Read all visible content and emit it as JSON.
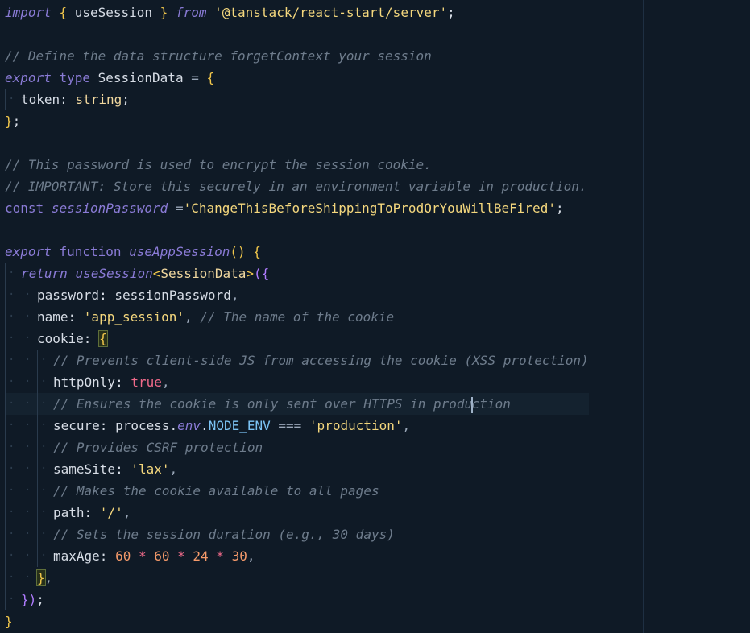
{
  "editor": {
    "language": "typescript",
    "accent": "#8a7bd6",
    "background": "#0f1a26",
    "active_line": 19
  },
  "code": {
    "l1_import": "import",
    "l1_open": "{",
    "l1_name": " useSession ",
    "l1_close": "}",
    "l1_from": "from",
    "l1_module": "'@tanstack/react-start/server'",
    "l1_semi": ";",
    "l3_comment": "// Define the data structure forgetContext your session",
    "l4_export": "export",
    "l4_type": "type",
    "l4_name": "SessionData",
    "l4_eq": " = ",
    "l4_brace": "{",
    "l5_key": "token",
    "l5_colon": ": ",
    "l5_type": "string",
    "l5_semi": ";",
    "l6_brace": "}",
    "l6_semi": ";",
    "l8_comment": "// This password is used to encrypt the session cookie.",
    "l9_comment": "// IMPORTANT: Store this securely in an environment variable in production.",
    "l10_const": "const",
    "l10_name": "sessionPassword",
    "l10_eq": " =",
    "l10_value": "'ChangeThisBeforeShippingToProdOrYouWillBeFired'",
    "l10_semi": ";",
    "l12_export": "export",
    "l12_function": "function",
    "l12_name": "useAppSession",
    "l12_parens": "()",
    "l12_brace": "{",
    "l13_return": "return",
    "l13_fn": "useSession",
    "l13_lt": "<",
    "l13_generic": "SessionData",
    "l13_gt": ">",
    "l13_open": "({",
    "l14_key": "password",
    "l14_colon": ": ",
    "l14_value": "sessionPassword",
    "l14_comma": ",",
    "l15_key": "name",
    "l15_colon": ": ",
    "l15_value": "'app_session'",
    "l15_comma": ",",
    "l15_comment": "// The name of the cookie",
    "l16_key": "cookie",
    "l16_colon": ": ",
    "l16_brace": "{",
    "l17_comment": "// Prevents client-side JS from accessing the cookie (XSS protection)",
    "l18_key": "httpOnly",
    "l18_colon": ": ",
    "l18_value": "true",
    "l18_comma": ",",
    "l19_comment_a": "// Ensures the cookie is only sent over HTTPS in produ",
    "l19_comment_b": "ction",
    "l20_key": "secure",
    "l20_colon": ": ",
    "l20_obj": "process",
    "l20_dot1": ".",
    "l20_env": "env",
    "l20_dot2": ".",
    "l20_var": "NODE_ENV",
    "l20_op": " === ",
    "l20_value": "'production'",
    "l20_comma": ",",
    "l21_comment": "// Provides CSRF protection",
    "l22_key": "sameSite",
    "l22_colon": ": ",
    "l22_value": "'lax'",
    "l22_comma": ",",
    "l23_comment": "// Makes the cookie available to all pages",
    "l24_key": "path",
    "l24_colon": ": ",
    "l24_value": "'/'",
    "l24_comma": ",",
    "l25_comment": "// Sets the session duration (e.g., 30 days)",
    "l26_key": "maxAge",
    "l26_colon": ": ",
    "l26_n1": "60",
    "l26_m1": " * ",
    "l26_n2": "60",
    "l26_m2": " * ",
    "l26_n3": "24",
    "l26_m3": " * ",
    "l26_n4": "30",
    "l26_comma": ",",
    "l27_brace": "}",
    "l27_comma": ",",
    "l28_close": "})",
    "l28_semi": ";",
    "l29_brace": "}"
  }
}
